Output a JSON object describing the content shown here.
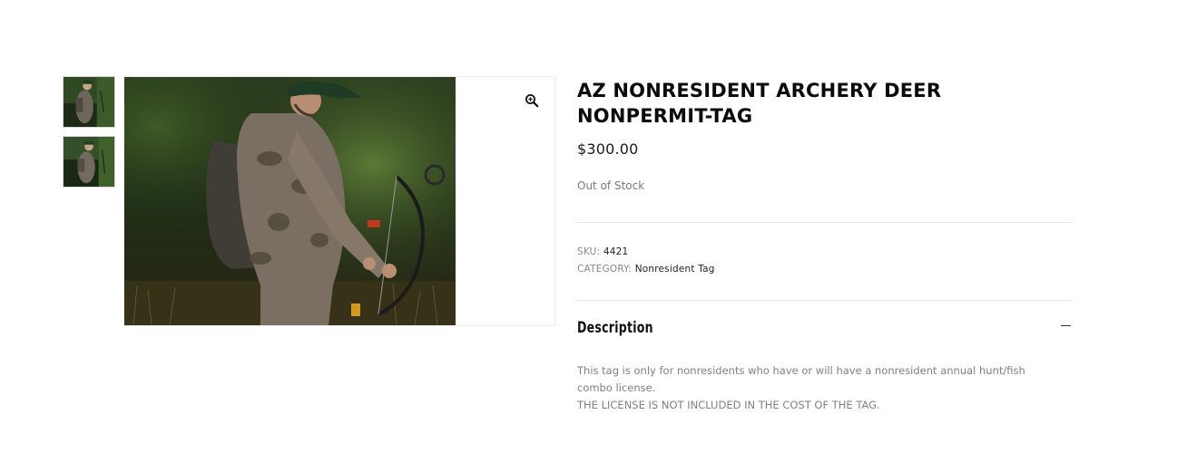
{
  "gallery": {
    "thumbnail_icon": "product-photo-thumbnail",
    "zoom_icon": "zoom-in-icon"
  },
  "product": {
    "title": "AZ NONRESIDENT ARCHERY DEER NONPERMIT-TAG",
    "price": "$300.00",
    "stock_status": "Out of Stock",
    "sku_label": "SKU:",
    "sku_value": "4421",
    "category_label": "CATEGORY:",
    "category_value": "Nonresident Tag"
  },
  "description": {
    "heading": "Description",
    "toggle_icon": "minus-icon",
    "line1": "This tag is only for nonresidents who have or will have a nonresident annual hunt/fish combo license.",
    "line2": "THE LICENSE IS NOT INCLUDED IN THE COST OF THE TAG."
  },
  "colors": {
    "text_primary": "#0b0b0b",
    "text_muted": "#808080",
    "divider": "#e6e6e6"
  }
}
